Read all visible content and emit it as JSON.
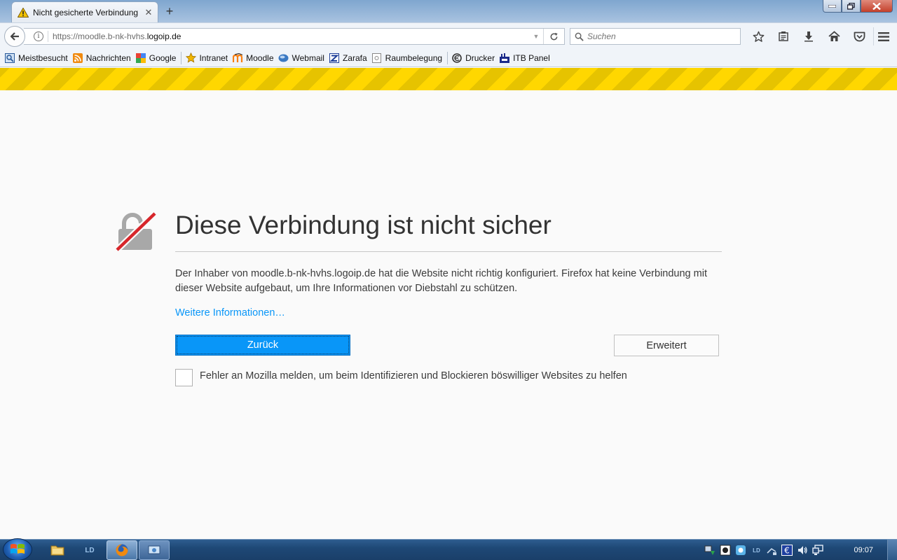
{
  "tab": {
    "title": "Nicht gesicherte Verbindung",
    "warning_icon": "warning-triangle-icon",
    "close_icon": "close-icon",
    "new_tab_label": "+"
  },
  "window_controls": [
    "minimize-icon",
    "maximize-icon",
    "close-icon"
  ],
  "navbar": {
    "url_prefix": "https://moodle.b-nk-hvhs.",
    "url_host": "logoip.de",
    "search_placeholder": "Suchen",
    "toolbar_icons": [
      "star-icon",
      "reading-list-icon",
      "download-icon",
      "home-icon",
      "pocket-icon"
    ],
    "menu_icon": "hamburger-menu-icon"
  },
  "bookmarks": [
    {
      "label": "Meistbesucht",
      "icon": "most-visited-icon"
    },
    {
      "label": "Nachrichten",
      "icon": "rss-icon"
    },
    {
      "label": "Google",
      "icon": "google-icon"
    },
    {
      "label": "Intranet",
      "icon": "star-icon"
    },
    {
      "label": "Moodle",
      "icon": "moodle-icon"
    },
    {
      "label": "Webmail",
      "icon": "webmail-icon"
    },
    {
      "label": "Zarafa",
      "icon": "zarafa-icon"
    },
    {
      "label": "Raumbelegung",
      "icon": "page-icon"
    },
    {
      "label": "Drucker",
      "icon": "printer-icon"
    },
    {
      "label": "ITB Panel",
      "icon": "itb-icon"
    }
  ],
  "error": {
    "title": "Diese Verbindung ist nicht sicher",
    "description": "Der Inhaber von moodle.b-nk-hvhs.logoip.de hat die Website nicht richtig konfiguriert. Firefox hat keine Verbindung mit dieser Website aufgebaut, um Ihre Informationen vor Diebstahl zu schützen.",
    "more_info_link": "Weitere Informationen…",
    "back_button": "Zurück",
    "advanced_button": "Erweitert",
    "report_checkbox_label": "Fehler an Mozilla melden, um beim Identifizieren und Blockieren böswilliger Websites zu helfen",
    "report_checked": false,
    "accent_color": "#0996f8",
    "stripe_color": "#ffd700"
  },
  "taskbar": {
    "apps": [
      "explorer-icon",
      "ld-icon",
      "firefox-icon",
      "remote-app-icon"
    ],
    "tray_icons": [
      "network-shield-icon",
      "security-icon",
      "app-tray-icon",
      "ld-tray-icon",
      "network-icon",
      "euro-icon",
      "volume-icon",
      "network-monitor-icon"
    ],
    "clock": "09:07"
  }
}
